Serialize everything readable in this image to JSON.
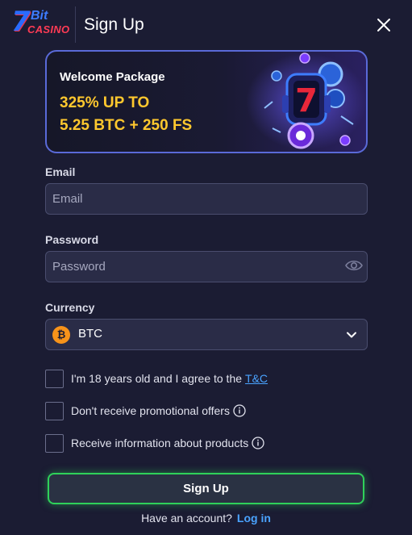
{
  "header": {
    "logo_text_top": "Bit",
    "logo_text_bottom": "CASINO",
    "logo_numeral": "7",
    "title": "Sign Up"
  },
  "banner": {
    "title": "Welcome Package",
    "line1": "325% UP TO",
    "line2": "5.25 BTC + 250 FS"
  },
  "form": {
    "email_label": "Email",
    "email_placeholder": "Email",
    "email_value": "",
    "password_label": "Password",
    "password_placeholder": "Password",
    "password_value": "",
    "currency_label": "Currency",
    "currency_value": "BTC",
    "currency_symbol": "₿"
  },
  "checkboxes": {
    "age_label": "I'm 18 years old and I agree to the",
    "tc_link": "T&C",
    "promo_label": "Don't receive promotional offers",
    "info_label": "Receive information about products"
  },
  "actions": {
    "signup_label": "Sign Up",
    "have_account": "Have an account?",
    "login_link": "Log in"
  },
  "colors": {
    "background": "#1b1c33",
    "accent_yellow": "#ffc82e",
    "link_blue": "#4aa3ff",
    "button_border_green": "#2fd15a",
    "bitcoin_orange": "#f7931a"
  },
  "icons": {
    "close": "close-icon",
    "eye": "eye-icon",
    "chevron": "chevron-down-icon",
    "info": "info-icon",
    "bitcoin": "bitcoin-icon"
  }
}
